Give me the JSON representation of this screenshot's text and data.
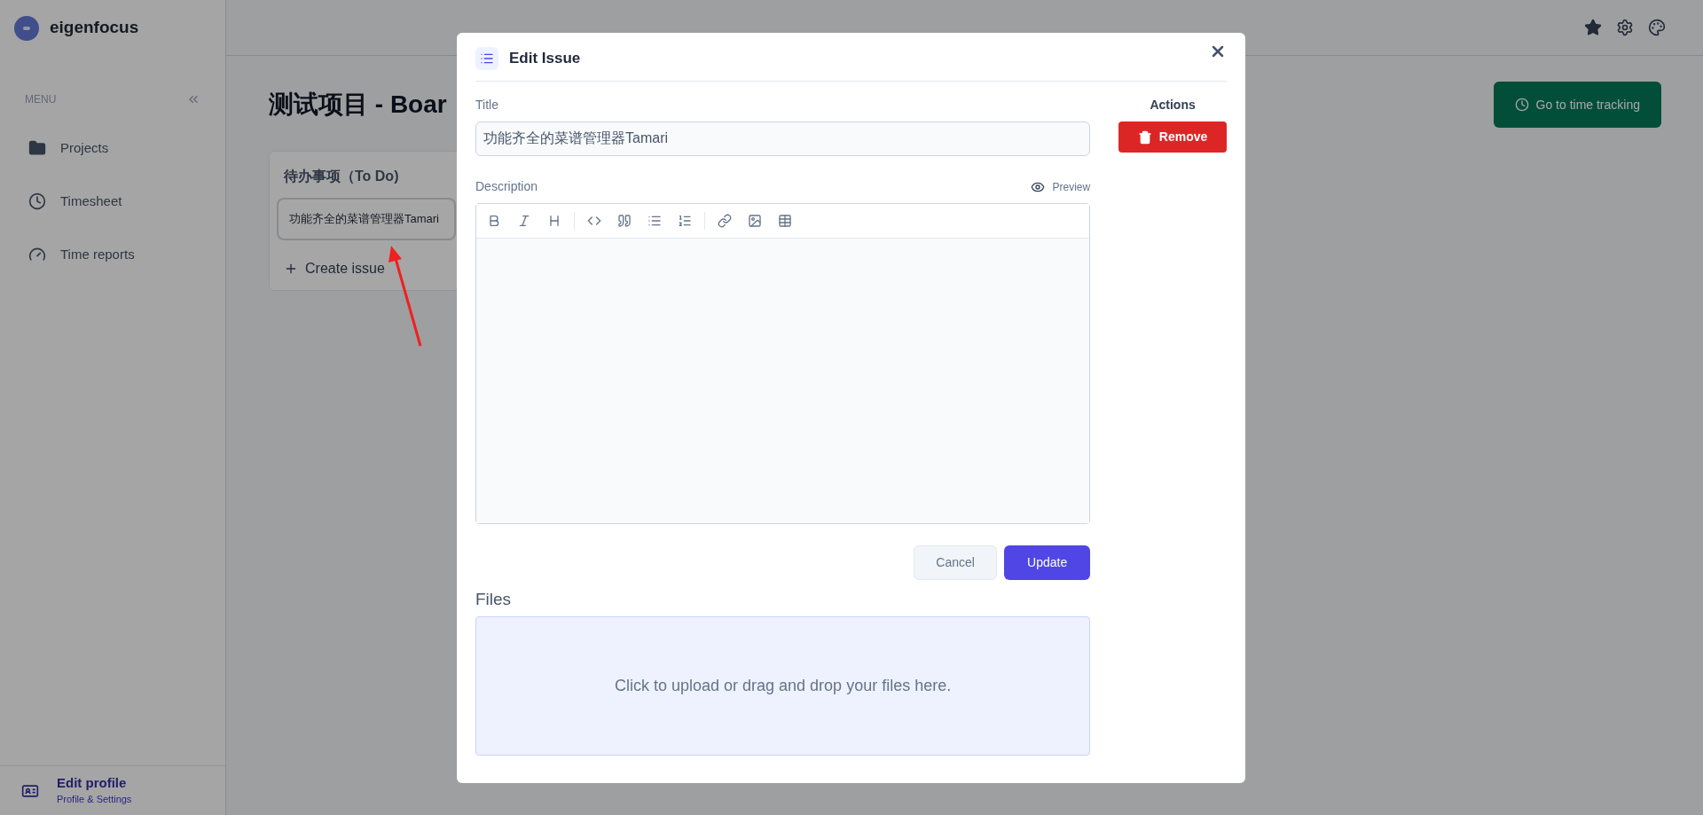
{
  "app": {
    "name": "eigenfocus"
  },
  "sidebar": {
    "menu_label": "MENU",
    "items": [
      {
        "kind": "folder",
        "label": "Projects"
      },
      {
        "kind": "clock",
        "label": "Timesheet"
      },
      {
        "kind": "gauge",
        "label": "Time reports"
      }
    ],
    "footer": {
      "title": "Edit profile",
      "subtitle": "Profile & Settings"
    }
  },
  "board": {
    "title": "测试项目 - Boar",
    "time_tracking_button": "Go to time tracking",
    "columns": [
      {
        "title": "待办事项（To Do)",
        "issues": [
          "功能齐全的菜谱管理器Tamari"
        ],
        "create_label": "Create issue"
      }
    ]
  },
  "modal": {
    "title": "Edit Issue",
    "title_label": "Title",
    "title_value": "功能齐全的菜谱管理器Tamari",
    "description_label": "Description",
    "preview_label": "Preview",
    "actions_label": "Actions",
    "remove_label": "Remove",
    "cancel_label": "Cancel",
    "update_label": "Update",
    "files_label": "Files",
    "dropzone_text": "Click to upload or drag and drop your files here."
  }
}
